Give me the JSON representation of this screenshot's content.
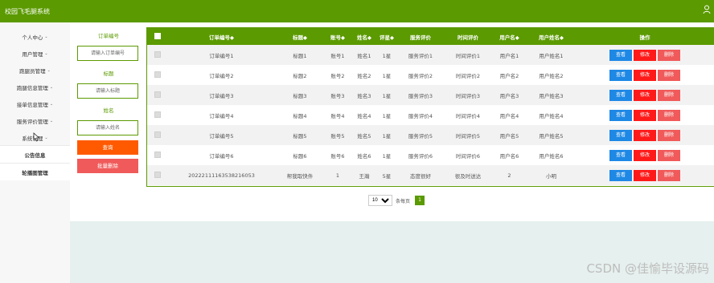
{
  "app": {
    "title": "校园飞毛腿系统"
  },
  "sidebar": {
    "items": [
      {
        "label": "个人中心",
        "caret": "⌄"
      },
      {
        "label": "用户管理",
        "caret": "⌄"
      },
      {
        "label": "跑腿员管理",
        "caret": "⌄"
      },
      {
        "label": "跑腿信息管理",
        "caret": "⌄"
      },
      {
        "label": "接单信息管理",
        "caret": "⌄"
      },
      {
        "label": "服务评价管理",
        "caret": "⌄"
      },
      {
        "label": "系统管理",
        "caret": "⌄"
      },
      {
        "label": "公告信息",
        "caret": ""
      },
      {
        "label": "轮播图管理",
        "caret": ""
      }
    ]
  },
  "filter": {
    "order_label": "订单编号",
    "order_placeholder": "请输入订单编号",
    "title_label": "标题",
    "title_placeholder": "请输入标题",
    "name_label": "姓名",
    "name_placeholder": "请输入姓名",
    "search_label": "查询",
    "bulk_delete_label": "批量删除"
  },
  "table": {
    "headers": [
      "订单编号◆",
      "标题◆",
      "账号◆",
      "姓名◆",
      "评星◆",
      "服务评价",
      "时间评价",
      "用户名◆",
      "用户姓名◆",
      "操作"
    ],
    "rows": [
      [
        "订单编号1",
        "标题1",
        "账号1",
        "姓名1",
        "1星",
        "服务评价1",
        "时间评价1",
        "用户名1",
        "用户姓名1"
      ],
      [
        "订单编号2",
        "标题2",
        "账号2",
        "姓名2",
        "1星",
        "服务评价2",
        "时间评价2",
        "用户名2",
        "用户姓名2"
      ],
      [
        "订单编号3",
        "标题3",
        "账号3",
        "姓名3",
        "1星",
        "服务评价3",
        "时间评价3",
        "用户名3",
        "用户姓名3"
      ],
      [
        "订单编号4",
        "标题4",
        "账号4",
        "姓名4",
        "1星",
        "服务评价4",
        "时间评价4",
        "用户名4",
        "用户姓名4"
      ],
      [
        "订单编号5",
        "标题5",
        "账号5",
        "姓名5",
        "1星",
        "服务评价5",
        "时间评价5",
        "用户名5",
        "用户姓名5"
      ],
      [
        "订单编号6",
        "标题6",
        "账号6",
        "姓名6",
        "1星",
        "服务评价6",
        "时间评价6",
        "用户名6",
        "用户姓名6"
      ],
      [
        "20222111163538216053",
        "帮我取快件",
        "1",
        "王瀚",
        "5星",
        "态度很好",
        "很及时送达",
        "2",
        "小明"
      ]
    ],
    "actions": {
      "view": "查看",
      "edit": "修改",
      "delete": "删除"
    }
  },
  "pagination": {
    "page_size": "10",
    "per_page_label": "条每页",
    "current_page": "1"
  },
  "watermark": "CSDN @佳愉毕设源码",
  "colors": {
    "primary": "#5b9a00",
    "search": "#ff5a00",
    "view": "#1e88e5",
    "edit": "#ff1a1a",
    "delete": "#f05a5a",
    "footer": "#e6f0ee"
  }
}
